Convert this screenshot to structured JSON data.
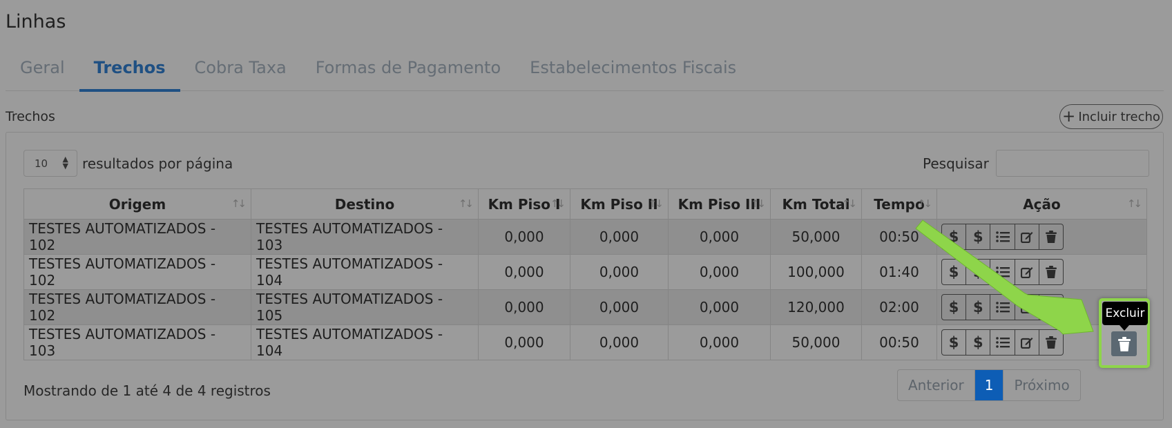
{
  "page": {
    "title": "Linhas"
  },
  "tabs": [
    {
      "label": "Geral"
    },
    {
      "label": "Trechos"
    },
    {
      "label": "Cobra Taxa"
    },
    {
      "label": "Formas de Pagamento"
    },
    {
      "label": "Estabelecimentos Fiscais"
    }
  ],
  "section": {
    "title": "Trechos",
    "add_label": "Incluir trecho"
  },
  "controls": {
    "page_size": "10",
    "page_size_label": "resultados por página",
    "search_label": "Pesquisar",
    "search_value": ""
  },
  "table": {
    "headers": [
      "Origem",
      "Destino",
      "Km Piso I",
      "Km Piso II",
      "Km Piso III",
      "Km Total",
      "Tempo",
      "Ação"
    ],
    "rows": [
      [
        "TESTES AUTOMATIZADOS - 102",
        "TESTES AUTOMATIZADOS - 103",
        "0,000",
        "0,000",
        "0,000",
        "50,000",
        "00:50"
      ],
      [
        "TESTES AUTOMATIZADOS - 102",
        "TESTES AUTOMATIZADOS - 104",
        "0,000",
        "0,000",
        "0,000",
        "100,000",
        "01:40"
      ],
      [
        "TESTES AUTOMATIZADOS - 102",
        "TESTES AUTOMATIZADOS - 105",
        "0,000",
        "0,000",
        "0,000",
        "120,000",
        "02:00"
      ],
      [
        "TESTES AUTOMATIZADOS - 103",
        "TESTES AUTOMATIZADOS - 104",
        "0,000",
        "0,000",
        "0,000",
        "50,000",
        "00:50"
      ]
    ],
    "action_icons": [
      "dollar-icon",
      "dollar-icon",
      "list-icon",
      "edit-icon",
      "trash-icon"
    ]
  },
  "footer": {
    "info": "Mostrando de 1 até 4 de 4 registros",
    "prev": "Anterior",
    "current": "1",
    "next": "Próximo"
  },
  "tooltip": {
    "label": "Excluir"
  },
  "colors": {
    "accent": "#1f5083",
    "page_active": "#0d5db5",
    "highlight": "#8ed54a"
  }
}
